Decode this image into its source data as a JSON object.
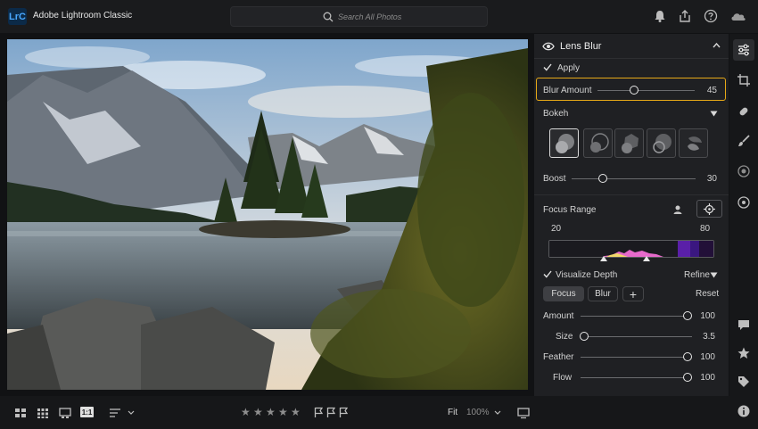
{
  "app": {
    "logo_text": "LrC",
    "title": "Adobe Lightroom Classic"
  },
  "search": {
    "placeholder": "Search All Photos"
  },
  "top_icons": [
    "bell-icon",
    "share-icon",
    "help-icon",
    "cloud-icon"
  ],
  "panel": {
    "title": "Lens Blur",
    "apply_label": "Apply",
    "blur_amount": {
      "label": "Blur Amount",
      "value": "45",
      "level": 45
    },
    "bokeh": {
      "label": "Bokeh",
      "options": [
        "circle",
        "bubble",
        "5-blade",
        "ring",
        "cat-eye"
      ],
      "selected": 0
    },
    "boost": {
      "label": "Boost",
      "value": "30",
      "level": 30
    },
    "focus_range": {
      "label": "Focus Range",
      "min": "20",
      "max": "80"
    },
    "visualize_depth_label": "Visualize Depth",
    "refine_label": "Refine",
    "tabs": {
      "focus": "Focus",
      "blur": "Blur",
      "add": "+"
    },
    "reset_label": "Reset",
    "amount": {
      "label": "Amount",
      "value": "100",
      "level": 100
    },
    "size": {
      "label": "Size",
      "value": "3.5",
      "level": 0
    },
    "feather": {
      "label": "Feather",
      "value": "100",
      "level": 100
    },
    "flow": {
      "label": "Flow",
      "value": "100",
      "level": 100
    }
  },
  "rail_icons": [
    "sliders-icon",
    "crop-icon",
    "healing-icon",
    "brush-icon",
    "redeye-icon",
    "preset-icon",
    "comment-icon",
    "star-icon",
    "tag-icon",
    "info-icon"
  ],
  "bottom": {
    "stars": [
      "★",
      "★",
      "★",
      "★",
      "★"
    ],
    "view_1to1": "1:1",
    "fit_label": "Fit",
    "zoom_label": "100%"
  },
  "colors": {
    "accent_highlight": "#e6a817",
    "panel_bg": "#1f2023",
    "app_bg": "#111214"
  }
}
